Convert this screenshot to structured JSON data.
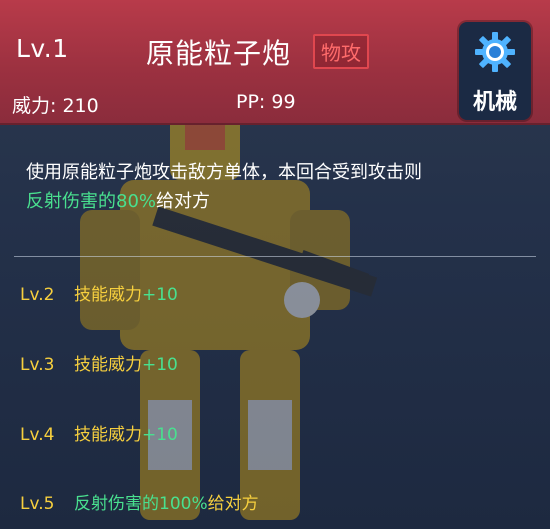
{
  "skill": {
    "level": "Lv.1",
    "name": "原能粒子炮",
    "category_tag": "物攻",
    "power_label": "威力: 210",
    "pp_label": "PP: 99",
    "type": {
      "icon": "gear-icon",
      "label": "机械"
    }
  },
  "description": {
    "line1": "使用原能粒子炮攻击敌方单体，本回合受到攻击则",
    "line2_highlight": "反射伤害的80%",
    "line2_rest": "给对方"
  },
  "upgrades": [
    {
      "level": "Lv.2",
      "text": "技能威力",
      "value": "+10"
    },
    {
      "level": "Lv.3",
      "text": "技能威力",
      "value": "+10"
    },
    {
      "level": "Lv.4",
      "text": "技能威力",
      "value": "+10"
    },
    {
      "level": "Lv.5",
      "text": "",
      "value": "反射伤害的100%",
      "suffix": "给对方"
    }
  ],
  "colors": {
    "header": "#9c3140",
    "tag_border": "#e0474f",
    "upgrade_level": "#f6cf3e",
    "highlight": "#49e08f"
  }
}
